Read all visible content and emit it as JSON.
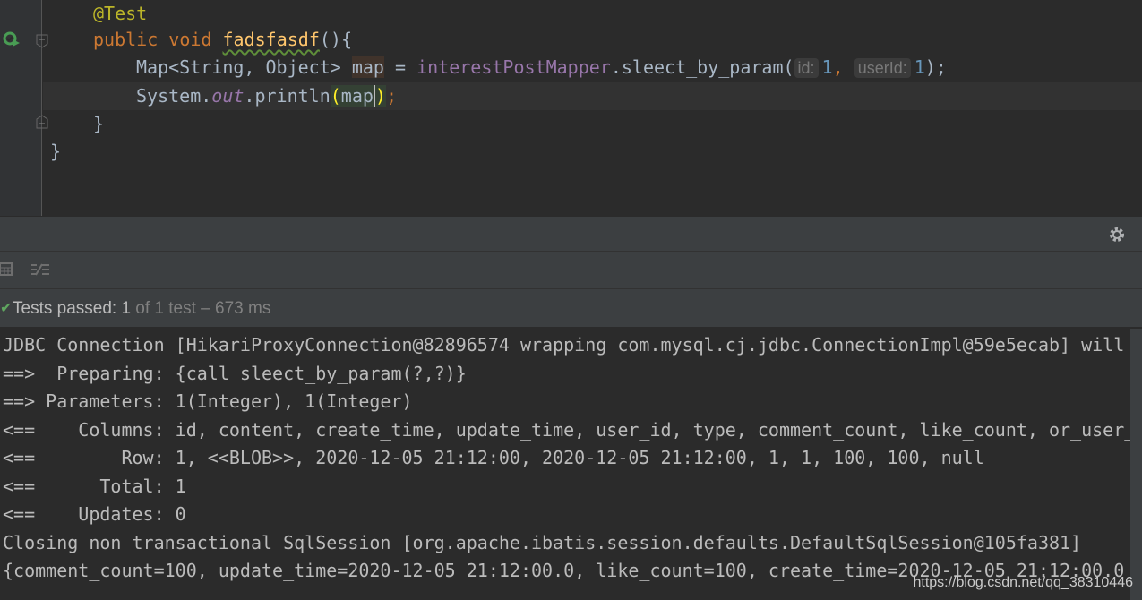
{
  "editor": {
    "annotation": "@Test",
    "kw_public": "public",
    "kw_void": "void",
    "method_name": "fadsfasdf",
    "method_tail": "(){",
    "line3_type": "Map<String, Object> ",
    "line3_var": "map",
    "line3_eq": " = ",
    "line3_field": "interestPostMapper",
    "line3_call": ".sleect_by_param(",
    "hint_id": "id:",
    "arg1": "1",
    "comma": ", ",
    "hint_userid": "userId:",
    "arg2": "1",
    "line3_end": ");",
    "line4_a": "System.",
    "line4_out": "out",
    "line4_b": ".println",
    "line4_open": "(",
    "line4_arg": "map",
    "line4_close": ")",
    "line4_end": ";",
    "close_method": "}",
    "close_class": "}"
  },
  "test_status": {
    "passed_label": "Tests passed: 1",
    "rest": " of 1 test – 673 ms"
  },
  "console_lines": [
    "JDBC Connection [HikariProxyConnection@82896574 wrapping com.mysql.cj.jdbc.ConnectionImpl@59e5ecab] will",
    "==>  Preparing: {call sleect_by_param(?,?)}",
    "==> Parameters: 1(Integer), 1(Integer)",
    "<==    Columns: id, content, create_time, update_time, user_id, type, comment_count, like_count, or_user_",
    "<==        Row: 1, <<BLOB>>, 2020-12-05 21:12:00, 2020-12-05 21:12:00, 1, 1, 100, 100, null",
    "<==      Total: 1",
    "<==    Updates: 0",
    "Closing non transactional SqlSession [org.apache.ibatis.session.defaults.DefaultSqlSession@105fa381]",
    "{comment_count=100, update_time=2020-12-05 21:12:00.0, like_count=100, create_time=2020-12-05 21:12:00.0"
  ],
  "watermark": "https://blog.csdn.net/qq_38310446"
}
